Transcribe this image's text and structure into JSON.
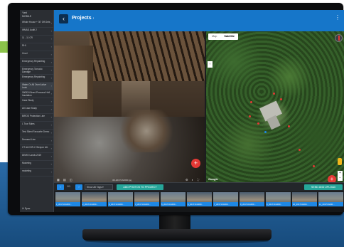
{
  "header": {
    "title": "Projects",
    "title_suffix": "›",
    "more": "⋮",
    "back": "‹"
  },
  "sidebar": {
    "top_lines": [
      "Yard",
      "MOBILE"
    ],
    "items": [
      {
        "label": "Whole House + 30' Off-Sets"
      },
      {
        "label": "WMAD Audit 2"
      },
      {
        "label": "11 - 11 CR"
      },
      {
        "label": "RHI"
      },
      {
        "label": "Cruel"
      },
      {
        "label": "Emergency Repainting"
      },
      {
        "label": "Emergency Tornado Damage"
      },
      {
        "label": "Emergency Repainting"
      },
      {
        "label": "Water Or All Over Active Leak"
      },
      {
        "label": "180524 Brent Personal Holl Insulation"
      },
      {
        "label": "Case Study"
      },
      {
        "label": "All Case Study"
      },
      {
        "label": "BIROS Protection Line"
      },
      {
        "label": "L Tour Sales"
      },
      {
        "label": "Test Silent Favourite Demo"
      },
      {
        "label": "Demand Line"
      },
      {
        "label": "CT ALCOR-C Sleeper Att."
      },
      {
        "label": "DEMO Lands 2019"
      },
      {
        "label": "Modeling"
      },
      {
        "label": "modeling"
      }
    ],
    "bottom": "Sync"
  },
  "photo": {
    "caption": "3D-2017CA0000.jpg",
    "fab": "+"
  },
  "map": {
    "tabs": [
      "Map",
      "Satellite"
    ],
    "selected_tab": "Satellite",
    "google": "Google",
    "fab": "+"
  },
  "toolbar": {
    "prev": "‹",
    "count": "1/1",
    "next": "›",
    "select_value": "Show All Tags",
    "add_button": "ADD PHOTOS TO PROJECT",
    "send_button": "SEND AND UPLOAD"
  },
  "film": [
    {
      "label": "1_20171CA000..."
    },
    {
      "label": "2_20171CA000..."
    },
    {
      "label": "3_20171CA000..."
    },
    {
      "label": "4_20171CA000..."
    },
    {
      "label": "5_20171CA000..."
    },
    {
      "label": "6_20171CA000..."
    },
    {
      "label": "7_20171CA000..."
    },
    {
      "label": "8_20171CA000..."
    },
    {
      "label": "9_20171CA000..."
    },
    {
      "label": "10_2017CA000..."
    },
    {
      "label": "11_2017CA000..."
    }
  ],
  "colors": {
    "accent": "#1676c9",
    "fab": "#e53935",
    "background_band": "#1f5c92",
    "green_tab": "#8bc34a"
  }
}
